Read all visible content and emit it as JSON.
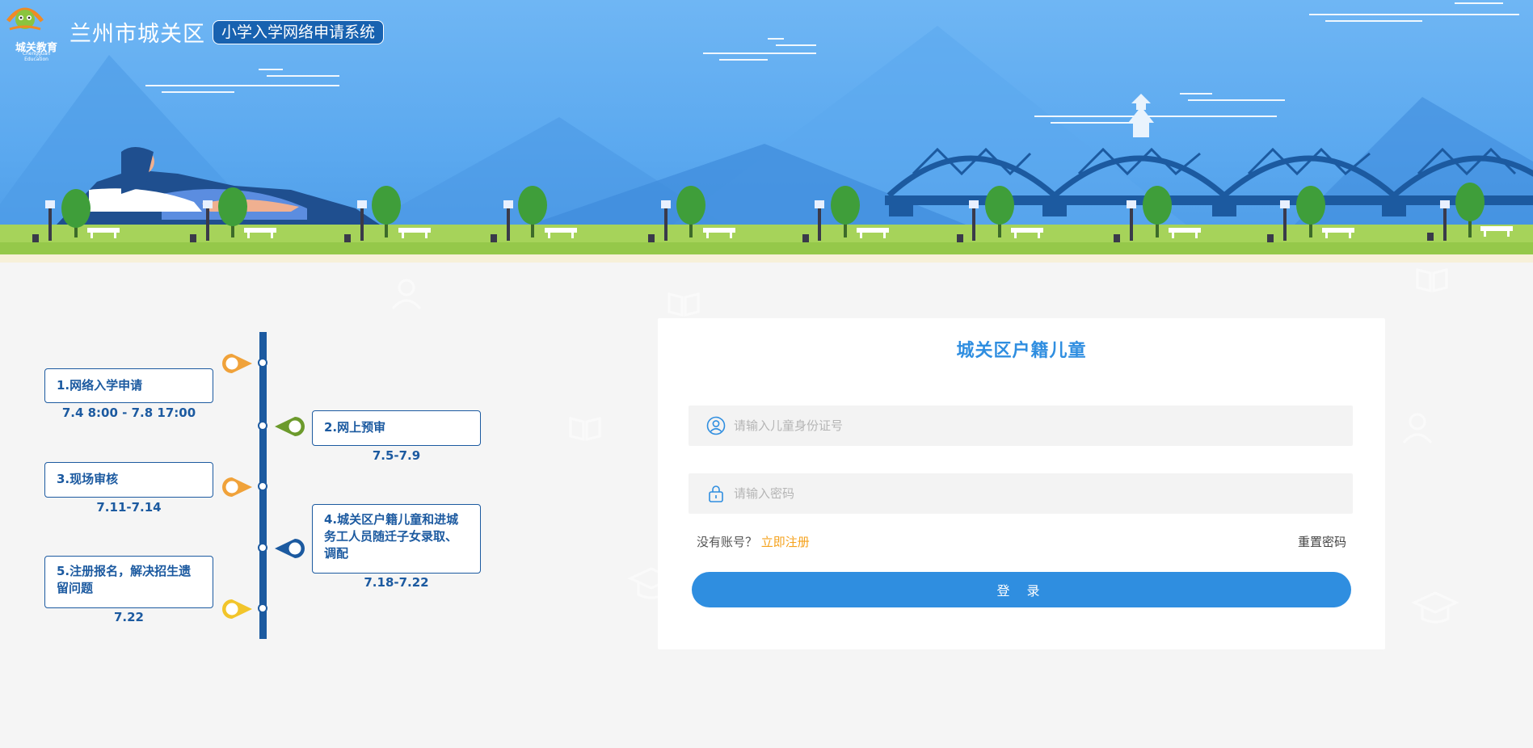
{
  "header": {
    "logo_text": "城关教育",
    "logo_subtext": "Chengguan Education",
    "site_title": "兰州市城关区",
    "system_name": "小学入学网络申请系统"
  },
  "timeline": {
    "steps": [
      {
        "label": "1.网络入学申请",
        "date": "7.4 8:00 - 7.8 17:00",
        "pin_color": "#f0a23a"
      },
      {
        "label": "2.网上预审",
        "date": "7.5-7.9",
        "pin_color": "#6c9a2c"
      },
      {
        "label": "3.现场审核",
        "date": "7.11-7.14",
        "pin_color": "#f0a23a"
      },
      {
        "label": "4.城关区户籍儿童和进城务工人员随迁子女录取、调配",
        "date": "7.18-7.22",
        "pin_color": "#1c5aa0"
      },
      {
        "label": "5.注册报名，解决招生遗留问题",
        "date": "7.22",
        "pin_color": "#f2c52b"
      }
    ]
  },
  "login": {
    "title": "城关区户籍儿童",
    "id_placeholder": "请输入儿童身份证号",
    "password_placeholder": "请输入密码",
    "no_account_text": "没有账号？",
    "register_label": "立即注册",
    "reset_label": "重置密码",
    "login_label": "登 录"
  },
  "icons": {
    "logo": "owl-book-logo-icon",
    "user": "user-icon",
    "lock": "lock-icon"
  },
  "colors": {
    "primary": "#2f8ee0",
    "timeline": "#1c5aa0",
    "accent": "#f5a21c"
  }
}
